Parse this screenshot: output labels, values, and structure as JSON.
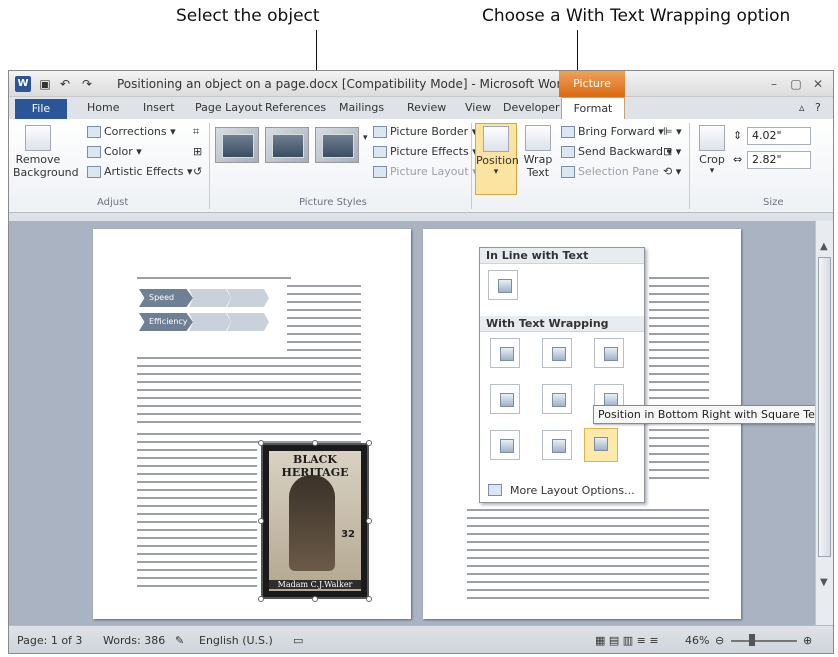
{
  "callouts": {
    "left": "Select the object",
    "right": "Choose a With Text Wrapping option"
  },
  "titlebar": {
    "title": "Positioning an object on a page.docx [Compatibility Mode] - Microsoft Word (T...",
    "context_tab": "Picture Tools",
    "logo": "W"
  },
  "tabs": {
    "file": "File",
    "items": [
      "Home",
      "Insert",
      "Page Layout",
      "References",
      "Mailings",
      "Review",
      "View",
      "Developer"
    ],
    "format": "Format"
  },
  "ribbon": {
    "remove_bg_line1": "Remove",
    "remove_bg_line2": "Background",
    "corrections": "Corrections",
    "color": "Color",
    "artistic": "Artistic Effects",
    "adjust_group": "Adjust",
    "picture_border": "Picture Border",
    "picture_effects": "Picture Effects",
    "picture_layout": "Picture Layout",
    "styles_group": "Picture Styles",
    "position": "Position",
    "wrap_text_line1": "Wrap",
    "wrap_text_line2": "Text",
    "bring_forward": "Bring Forward",
    "send_backward": "Send Backward",
    "selection_pane": "Selection Pane",
    "crop": "Crop",
    "height": "4.02\"",
    "width": "2.82\"",
    "size_group": "Size"
  },
  "smartart": {
    "speed": "Speed",
    "efficiency": "Efficiency"
  },
  "stamp": {
    "header": "BLACK HERITAGE",
    "price": "32",
    "name": "Madam C.J.Walker"
  },
  "gallery": {
    "inline_header": "In Line with Text",
    "wrap_header": "With Text Wrapping",
    "more": "More Layout Options..."
  },
  "tooltip": "Position in Bottom Right with Square Text Wrapping",
  "status": {
    "page": "Page: 1 of 3",
    "words": "Words: 386",
    "lang": "English (U.S.)",
    "zoom": "46%"
  }
}
